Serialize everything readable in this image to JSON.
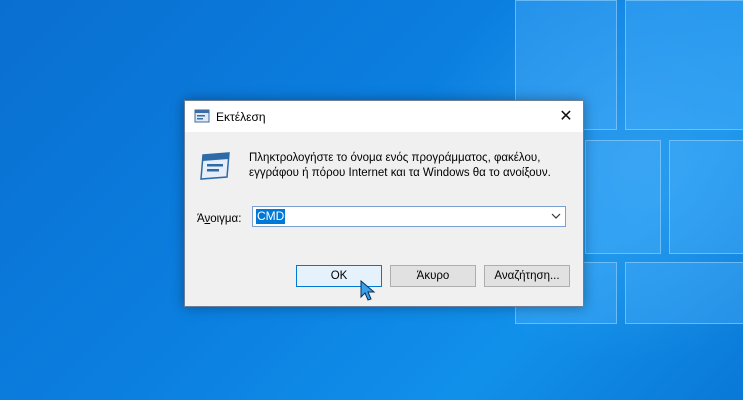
{
  "dialog": {
    "title": "Εκτέλεση",
    "prompt": "Πληκτρολογήστε το όνομα ενός προγράμματος, φακέλου, εγγράφου ή πόρου Internet και τα Windows θα το ανοίξουν.",
    "open_label_prefix": "Ά",
    "open_label_underlined": "ν",
    "open_label_suffix": "οιγμα:",
    "open_value": "CMD",
    "ok_label": "OK",
    "cancel_label": "Άκυρο",
    "browse_label": "Αναζήτηση...",
    "close_glyph": "✕"
  },
  "icons": {
    "title": "run-icon",
    "main": "run-icon",
    "dropdown": "chevron-down-icon",
    "cursor": "mouse-pointer-icon"
  },
  "colors": {
    "desktop": "#0b7fe0",
    "selection": "#0078d7",
    "ok_border": "#0078d7"
  }
}
